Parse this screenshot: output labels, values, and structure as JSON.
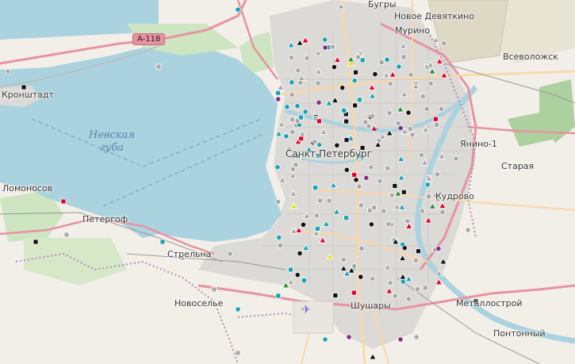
{
  "map": {
    "water_label_line1": "Невская",
    "water_label_line2": "губа",
    "road_shield": "A-118",
    "places": {
      "bugry": "Бугры",
      "novoe_devyatkino": "Новое Девяткино",
      "murino": "Мурино",
      "vsevolozhsk": "Всеволожск",
      "kronshtadt": "Кронштадт",
      "yanino": "Янино-1",
      "staraya": "Старая",
      "kudrovo": "Кудрово",
      "lomonosov": "Ломоносов",
      "petergof": "Петергоф",
      "strelna": "Стрельна",
      "novoselye": "Новоселье",
      "shushary": "Шушары",
      "metallostroy": "Металлострой",
      "pontonny": "Понтонный",
      "spb": "Санкт-Петербург"
    },
    "colors": {
      "land": "#f2efe9",
      "water": "#aad3df",
      "city": "#dcdad6",
      "forest": "#add19e",
      "road_major": "#e892a2",
      "road_orange": "#fcd6a4",
      "marker_red": "#e4002b",
      "marker_teal": "#1aa3b0",
      "marker_black": "#111111",
      "marker_gray": "#a9a9a9",
      "marker_purple": "#8a2b8a",
      "marker_green": "#2e8b3a",
      "marker_yellow": "#e6e600"
    },
    "icons": [
      "airport-icon"
    ]
  }
}
